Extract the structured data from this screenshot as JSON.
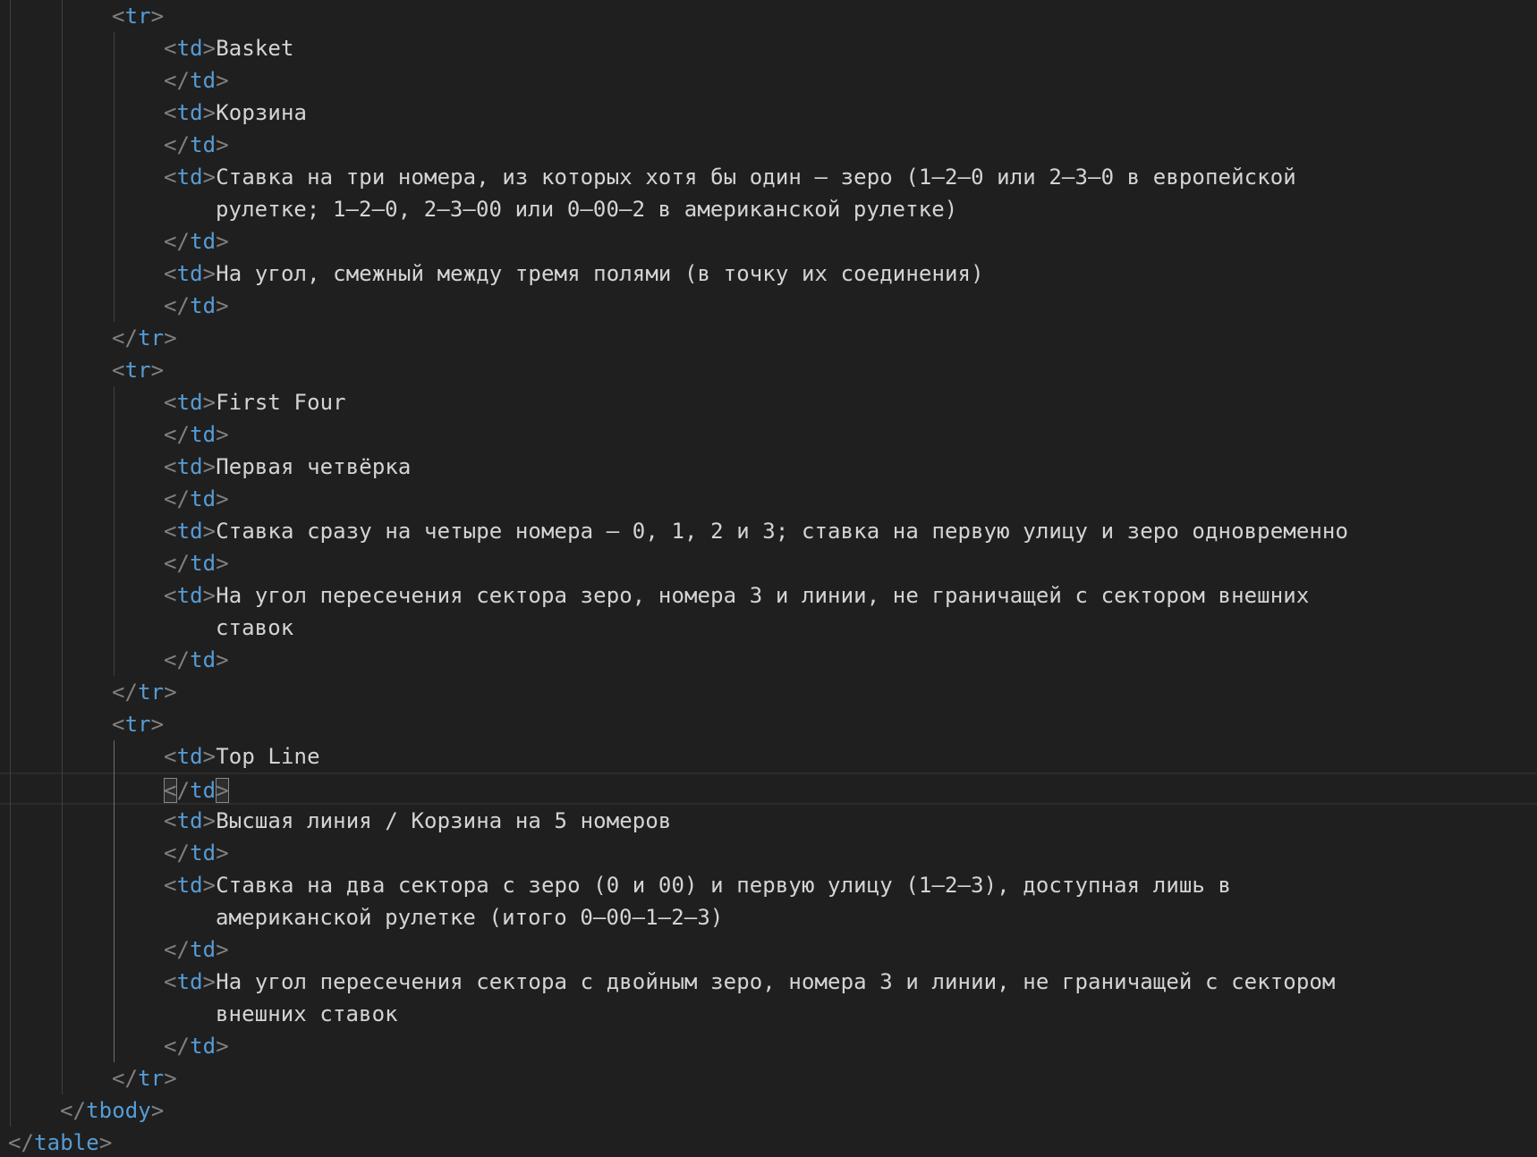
{
  "editor": {
    "language": "html",
    "colors": {
      "background": "#1f1f1f",
      "bracket": "#808080",
      "tag": "#569cd6",
      "text": "#d4d4d4",
      "indent_guide": "#404040",
      "cursor_line": "#2b2b2b"
    },
    "lines": [
      {
        "indent": 2,
        "kind": "open",
        "tag": "tr",
        "text": ""
      },
      {
        "indent": 3,
        "kind": "open",
        "tag": "td",
        "text": "Basket"
      },
      {
        "indent": 3,
        "kind": "close",
        "tag": "td",
        "text": ""
      },
      {
        "indent": 3,
        "kind": "open",
        "tag": "td",
        "text": "Корзина"
      },
      {
        "indent": 3,
        "kind": "close",
        "tag": "td",
        "text": ""
      },
      {
        "indent": 3,
        "kind": "open",
        "tag": "td",
        "text": "Ставка на три номера, из которых хотя бы один — зеро (1–2–0 или 2–3–0 в европейской"
      },
      {
        "indent": 3,
        "kind": "wrap",
        "tag": "",
        "text": "рулетке; 1–2–0, 2–3–00 или 0–00–2 в американской рулетке)"
      },
      {
        "indent": 3,
        "kind": "close",
        "tag": "td",
        "text": ""
      },
      {
        "indent": 3,
        "kind": "open",
        "tag": "td",
        "text": "На угол, смежный между тремя полями (в точку их соединения)"
      },
      {
        "indent": 3,
        "kind": "close",
        "tag": "td",
        "text": ""
      },
      {
        "indent": 2,
        "kind": "close",
        "tag": "tr",
        "text": ""
      },
      {
        "indent": 2,
        "kind": "open",
        "tag": "tr",
        "text": ""
      },
      {
        "indent": 3,
        "kind": "open",
        "tag": "td",
        "text": "First Four"
      },
      {
        "indent": 3,
        "kind": "close",
        "tag": "td",
        "text": ""
      },
      {
        "indent": 3,
        "kind": "open",
        "tag": "td",
        "text": "Первая четвёрка"
      },
      {
        "indent": 3,
        "kind": "close",
        "tag": "td",
        "text": ""
      },
      {
        "indent": 3,
        "kind": "open",
        "tag": "td",
        "text": "Ставка сразу на четыре номера — 0, 1, 2 и 3; ставка на первую улицу и зеро одновременно"
      },
      {
        "indent": 3,
        "kind": "close",
        "tag": "td",
        "text": ""
      },
      {
        "indent": 3,
        "kind": "open",
        "tag": "td",
        "text": "На угол пересечения сектора зеро, номера 3 и линии, не граничащей с сектором внешних"
      },
      {
        "indent": 3,
        "kind": "wrap",
        "tag": "",
        "text": "ставок"
      },
      {
        "indent": 3,
        "kind": "close",
        "tag": "td",
        "text": ""
      },
      {
        "indent": 2,
        "kind": "close",
        "tag": "tr",
        "text": ""
      },
      {
        "indent": 2,
        "kind": "open",
        "tag": "tr",
        "text": ""
      },
      {
        "indent": 3,
        "kind": "open",
        "tag": "td",
        "text": "Top Line"
      },
      {
        "indent": 3,
        "kind": "close",
        "tag": "td",
        "text": "",
        "cursor": true
      },
      {
        "indent": 3,
        "kind": "open",
        "tag": "td",
        "text": "Высшая линия / Корзина на 5 номеров"
      },
      {
        "indent": 3,
        "kind": "close",
        "tag": "td",
        "text": ""
      },
      {
        "indent": 3,
        "kind": "open",
        "tag": "td",
        "text": "Ставка на два сектора с зеро (0 и 00) и первую улицу (1–2–3), доступная лишь в"
      },
      {
        "indent": 3,
        "kind": "wrap",
        "tag": "",
        "text": "американской рулетке (итого 0–00–1–2–3)"
      },
      {
        "indent": 3,
        "kind": "close",
        "tag": "td",
        "text": ""
      },
      {
        "indent": 3,
        "kind": "open",
        "tag": "td",
        "text": "На угол пересечения сектора с двойным зеро, номера 3 и линии, не граничащей с сектором"
      },
      {
        "indent": 3,
        "kind": "wrap",
        "tag": "",
        "text": "внешних ставок"
      },
      {
        "indent": 3,
        "kind": "close",
        "tag": "td",
        "text": ""
      },
      {
        "indent": 2,
        "kind": "close",
        "tag": "tr",
        "text": ""
      },
      {
        "indent": 1,
        "kind": "close",
        "tag": "tbody",
        "text": ""
      },
      {
        "indent": 0,
        "kind": "close",
        "tag": "table",
        "text": ""
      }
    ]
  }
}
